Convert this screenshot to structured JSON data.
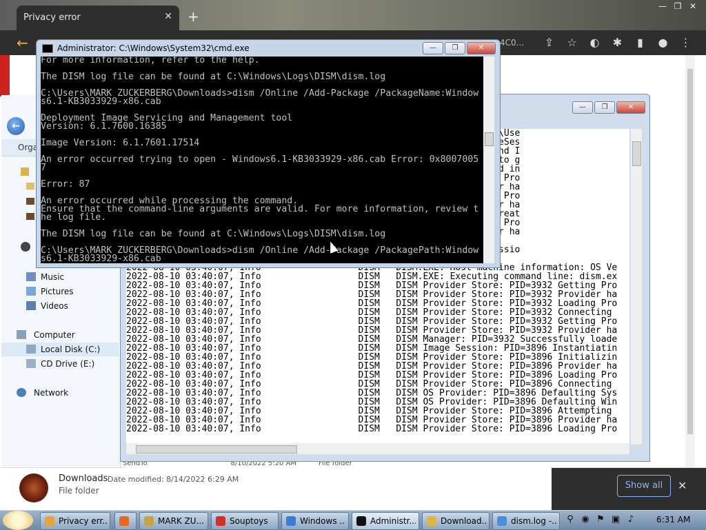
{
  "chrome": {
    "tab_title": "Privacy error",
    "tab_close": "✕",
    "new_tab": "+",
    "back": "←",
    "omnibox_tail": "4C0...",
    "window_controls": [
      "—",
      "❐",
      "✕"
    ],
    "toolbar_icons": [
      "share-icon",
      "star-icon",
      "profile-icon",
      "extensions-icon",
      "sidebar-icon",
      "account-icon",
      "menu-icon"
    ]
  },
  "download_bar": {
    "file_name": "Downloads",
    "meta": "Date modified: 8/14/2022 6:29 AM",
    "type": "File folder",
    "show_all": "Show all",
    "close": "✕"
  },
  "explorer": {
    "organize": "Orga",
    "nav": [
      {
        "label": "Music",
        "top": false
      },
      {
        "label": "Pictures",
        "top": false
      },
      {
        "label": "Videos",
        "top": false
      },
      {
        "label": "Computer",
        "top": true
      },
      {
        "label": "Local Disk (C:)",
        "top": false,
        "selected": true
      },
      {
        "label": "CD Drive (E:)",
        "top": false
      },
      {
        "label": "Network",
        "top": true
      }
    ],
    "peek_row": "SendTo                                      8/10/2022 5:20 AM          File folder"
  },
  "notepad": {
    "window_controls": [
      "—",
      "❐",
      "✕"
    ],
    "lines": [
      "                                                  irectory set to 'C:\\Use",
      "                                                  lly loaded the ImageSes",
      "                                                  e: PID=3932 Found and I",
      "                                                  e: PID=3932 Failed to g",
      "                                                  e: PID=3932 Finished in",
      "                                                  e: PID=3932 Getting Pro",
      "                                                  e: PID=3932 Provider ha",
      "                                                  e: PID=3932 Getting Pro",
      "                                                  e: PID=3932 Provider ha",
      "                                                  3932 Successfully creat",
      "                                                  e: PID=3932 Getting Pro",
      "                                                  e: PID=3932 Provider ha",
      "",
      "                                                  tarting Dism.exe sessio",
      "",
      "2022-08-10 03:40:07, Info                  DISM   DISM.EXE: Host machine information: OS Ve",
      "2022-08-10 03:40:07, Info                  DISM   DISM.EXE: Executing command line: dism.ex",
      "2022-08-10 03:40:07, Info                  DISM   DISM Provider Store: PID=3932 Getting Pro",
      "2022-08-10 03:40:07, Info                  DISM   DISM Provider Store: PID=3932 Provider ha",
      "2022-08-10 03:40:07, Info                  DISM   DISM Provider Store: PID=3932 Loading Pro",
      "2022-08-10 03:40:07, Info                  DISM   DISM Provider Store: PID=3932 Connecting",
      "2022-08-10 03:40:07, Info                  DISM   DISM Provider Store: PID=3932 Getting Pro",
      "2022-08-10 03:40:07, Info                  DISM   DISM Provider Store: PID=3932 Provider ha",
      "2022-08-10 03:40:07, Info                  DISM   DISM Manager: PID=3932 Successfully loade",
      "2022-08-10 03:40:07, Info                  DISM   DISM Image Session: PID=3896 Instantiatin",
      "2022-08-10 03:40:07, Info                  DISM   DISM Provider Store: PID=3896 Initializin",
      "2022-08-10 03:40:07, Info                  DISM   DISM Provider Store: PID=3896 Provider ha",
      "2022-08-10 03:40:07, Info                  DISM   DISM Provider Store: PID=3896 Loading Pro",
      "2022-08-10 03:40:07, Info                  DISM   DISM Provider Store: PID=3896 Connecting",
      "2022-08-10 03:40:07, Info                  DISM   DISM OS Provider: PID=3896 Defaulting Sys",
      "2022-08-10 03:40:07, Info                  DISM   DISM OS Provider: PID=3896 Defaulting Win",
      "2022-08-10 03:40:07, Info                  DISM   DISM Provider Store: PID=3896 Attempting",
      "2022-08-10 03:40:07, Info                  DISM   DISM Provider Store: PID=3896 Provider ha",
      "2022-08-10 03:40:07, Info                  DISM   DISM Provider Store: PID=3896 Loading Pro"
    ]
  },
  "cmd": {
    "title": "Administrator: C:\\Windows\\System32\\cmd.exe",
    "window_controls": [
      "—",
      "❐",
      "✕"
    ],
    "lines": [
      "For more information, refer to the help.",
      "",
      "The DISM log file can be found at C:\\Windows\\Logs\\DISM\\dism.log",
      "",
      "C:\\Users\\MARK ZUCKERBERG\\Downloads>dism /Online /Add-Package /PackageName:Window",
      "s6.1-KB3033929-x86.cab",
      "",
      "Deployment Image Servicing and Management tool",
      "Version: 6.1.7600.16385",
      "",
      "Image Version: 6.1.7601.17514",
      "",
      "An error occurred trying to open - Windows6.1-KB3033929-x86.cab Error: 0x8007005",
      "7",
      "",
      "Error: 87",
      "",
      "An error occurred while processing the command.",
      "Ensure that the command-line arguments are valid. For more information, review t",
      "he log file.",
      "",
      "The DISM log file can be found at C:\\Windows\\Logs\\DISM\\dism.log",
      "",
      "C:\\Users\\MARK ZUCKERBERG\\Downloads>dism /Online /Add-Package /PackagePath:Window",
      "s6.1-KB3033929-x86.cab"
    ]
  },
  "taskbar": {
    "buttons": [
      {
        "label": "Privacy err...",
        "color": "#e7a33e"
      },
      {
        "label": "",
        "color": "#e66a1e"
      },
      {
        "label": "MARK ZU...",
        "color": "#c8a14b"
      },
      {
        "label": "Souptoys",
        "color": "#d2302b"
      },
      {
        "label": "Windows ...",
        "color": "#3a7bd5"
      },
      {
        "label": "Administr...",
        "color": "#111111"
      },
      {
        "label": "Download...",
        "color": "#e0b640"
      },
      {
        "label": "dism.log -...",
        "color": "#4a8fd8"
      }
    ],
    "clock": "6:31 AM"
  }
}
